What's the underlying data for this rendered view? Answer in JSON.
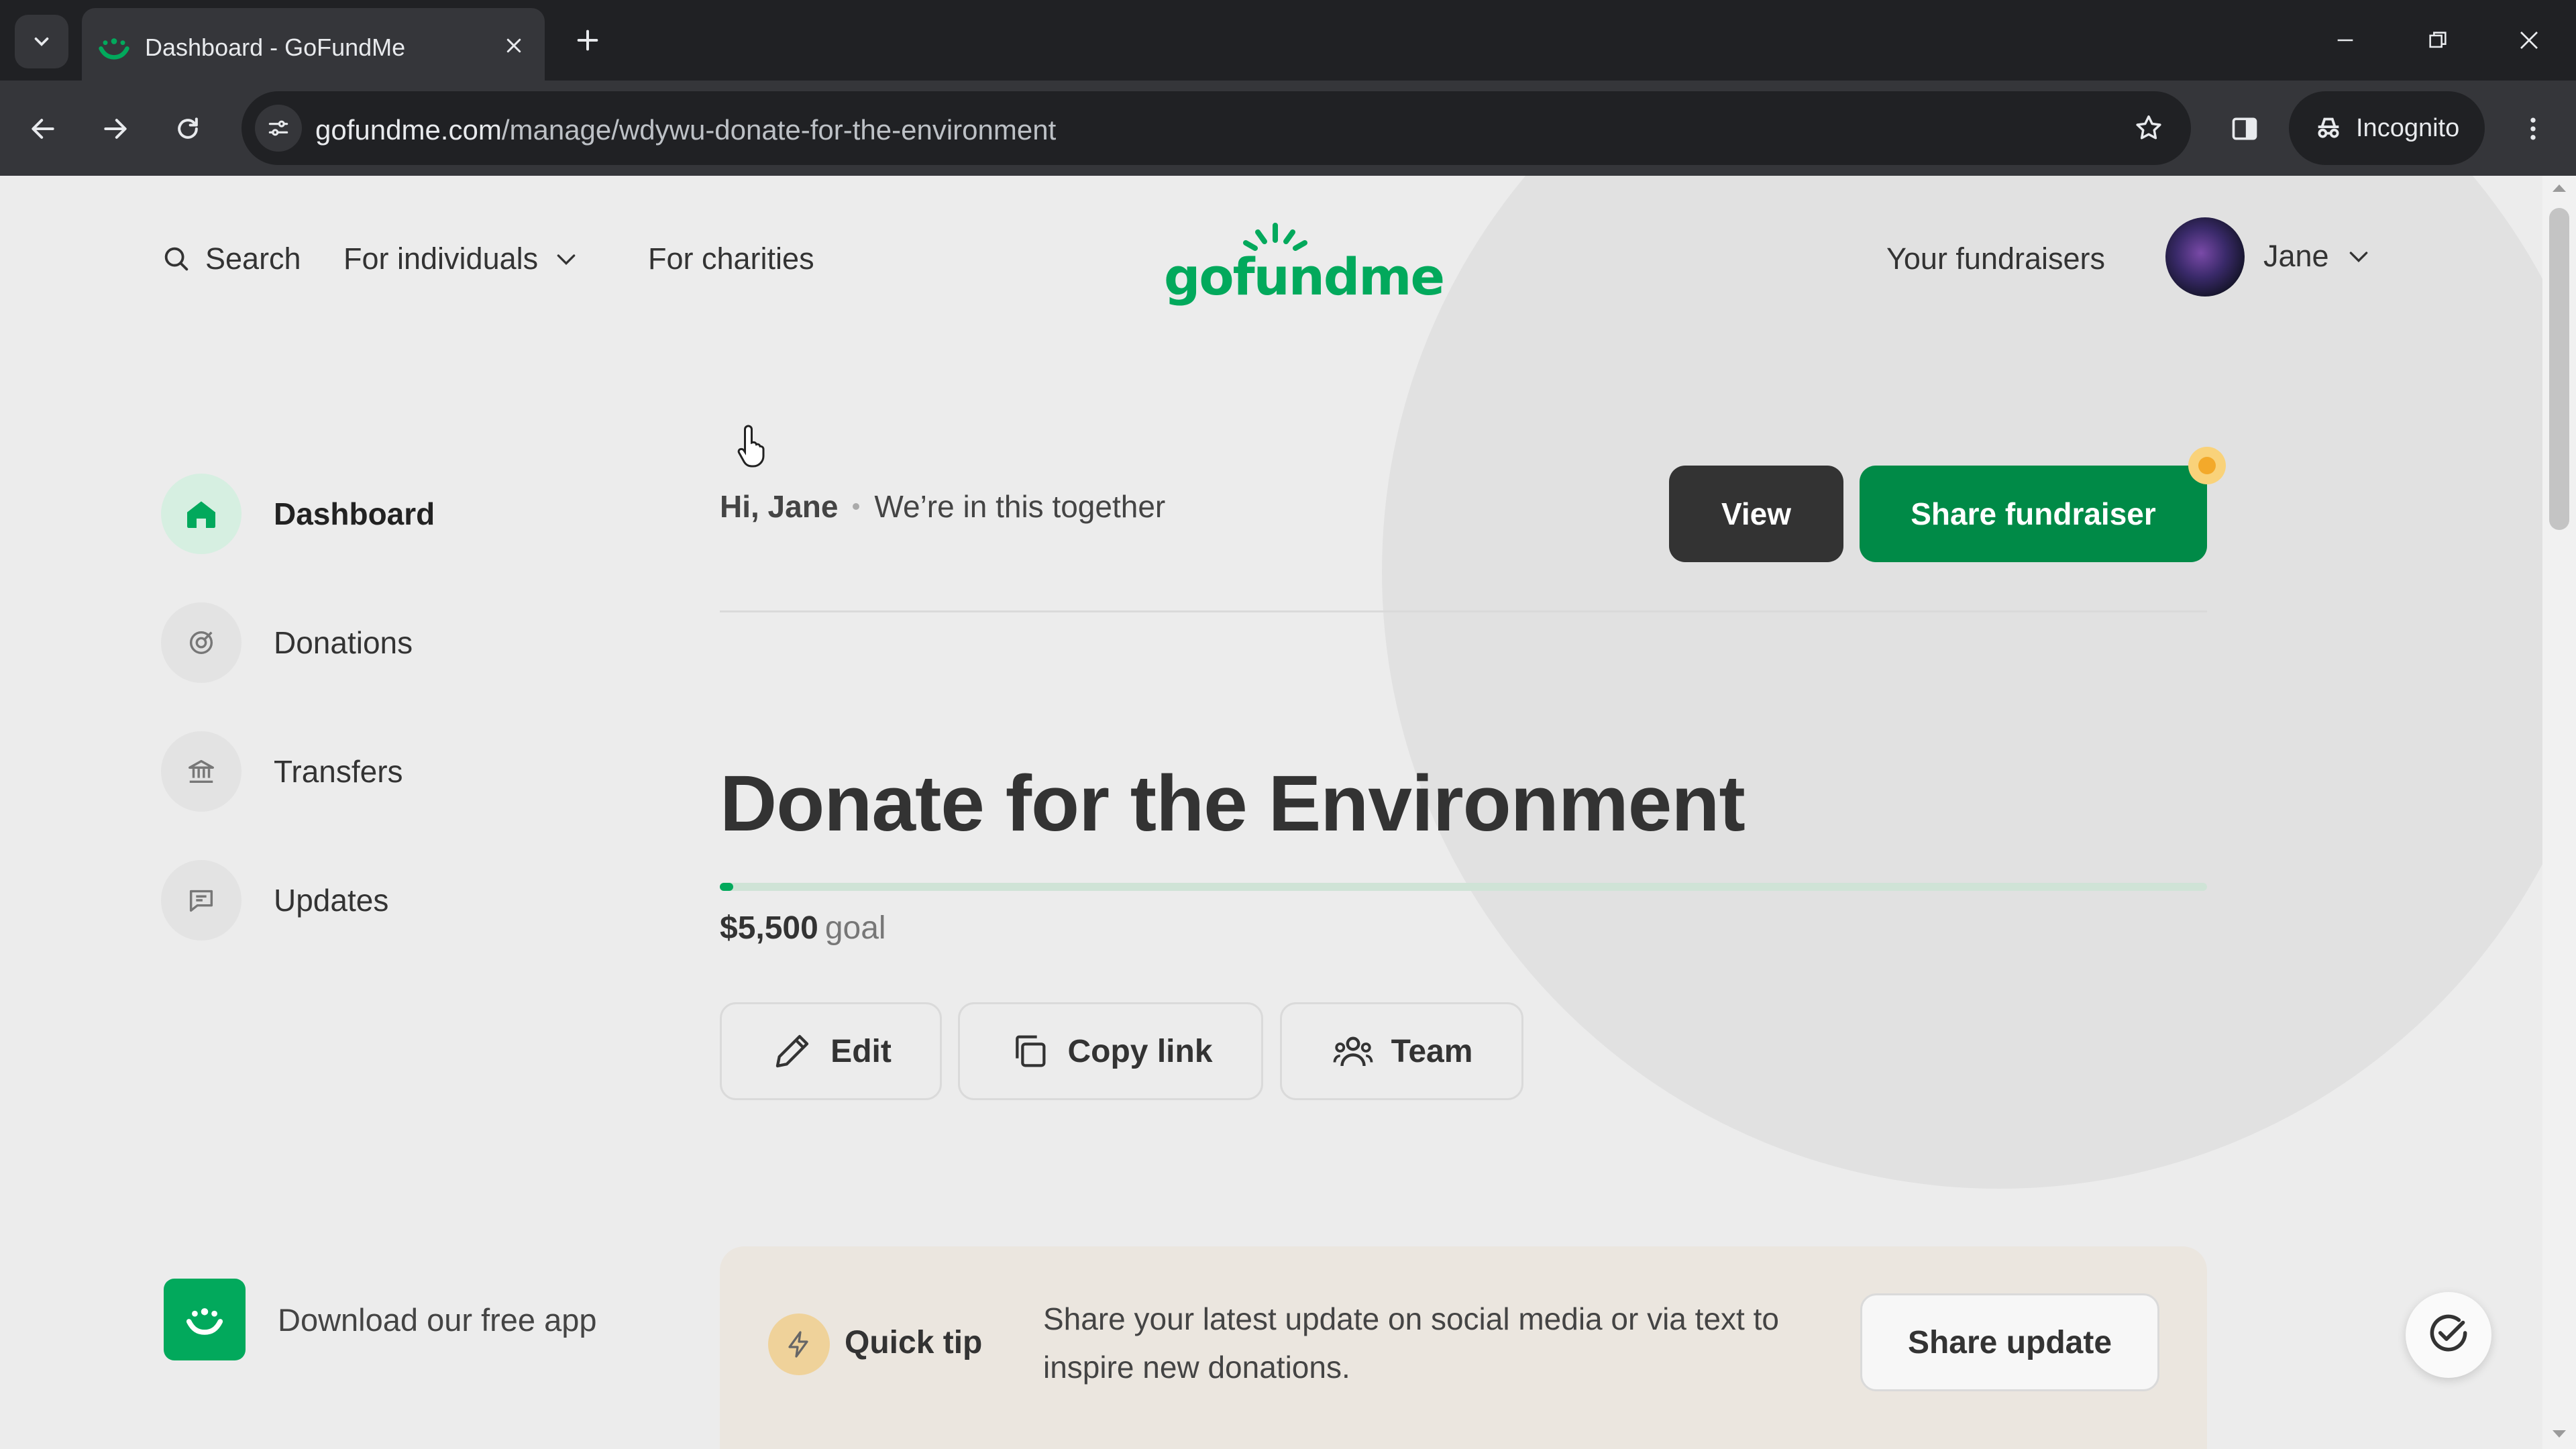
{
  "browser": {
    "tab_title": "Dashboard - GoFundMe",
    "url_host": "gofundme.com",
    "url_path": "/manage/wdywu-donate-for-the-environment",
    "incognito_label": "Incognito"
  },
  "topnav": {
    "search_label": "Search",
    "for_individuals_label": "For individuals",
    "for_charities_label": "For charities",
    "logo_text": "gofundme",
    "your_fundraisers_label": "Your fundraisers",
    "user_name": "Jane"
  },
  "sidebar": {
    "items": [
      {
        "label": "Dashboard",
        "icon": "home-icon",
        "active": true
      },
      {
        "label": "Donations",
        "icon": "donations-icon",
        "active": false
      },
      {
        "label": "Transfers",
        "icon": "bank-icon",
        "active": false
      },
      {
        "label": "Updates",
        "icon": "message-icon",
        "active": false
      }
    ],
    "download_app_label": "Download our free app"
  },
  "header": {
    "greeting": "Hi, Jane",
    "tagline": "We’re in this together",
    "view_label": "View",
    "share_fundraiser_label": "Share fundraiser"
  },
  "fundraiser": {
    "title": "Donate for the Environment",
    "goal_amount": "$5,500",
    "goal_label": "goal",
    "progress_fraction": 0.004
  },
  "actions": {
    "edit_label": "Edit",
    "copy_link_label": "Copy link",
    "team_label": "Team"
  },
  "quick_tip": {
    "title": "Quick tip",
    "text": "Share your latest update on social media or via text to inspire new donations.",
    "button_label": "Share update"
  },
  "colors": {
    "brand_green": "#02a95c",
    "share_button_green": "#008a47",
    "view_button_dark": "#333333",
    "notification_orange": "#f3a92a"
  }
}
